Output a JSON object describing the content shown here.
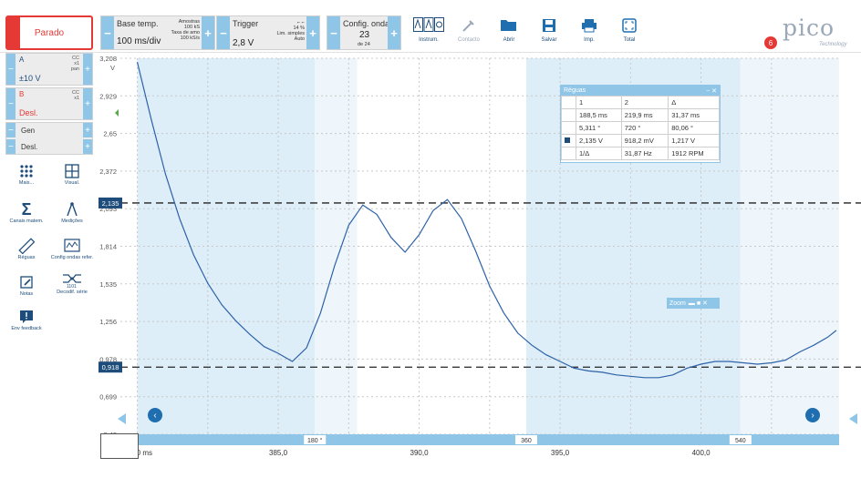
{
  "toolbar": {
    "stop_label": "Parado",
    "timebase": {
      "label": "Base temp.",
      "value": "100 ms/div",
      "samples_label": "Amostras",
      "samples_value": "100 kS",
      "rate_label": "Taxa de amo",
      "rate_value": "100 kS/s"
    },
    "trigger": {
      "label": "Trigger",
      "value": "2,8 V",
      "pct": "14 %",
      "mode": "Lim. simples",
      "auto": "Auto"
    },
    "config": {
      "label": "Config. onda",
      "value": "23",
      "sub": "de 24"
    },
    "icons": [
      {
        "name": "instrument-icon",
        "label": "Instrum."
      },
      {
        "name": "contact-icon",
        "label": "Contacto"
      },
      {
        "name": "open-icon",
        "label": "Abrir"
      },
      {
        "name": "save-icon",
        "label": "Salvar"
      },
      {
        "name": "print-icon",
        "label": "Imp."
      },
      {
        "name": "fullscreen-icon",
        "label": "Total"
      }
    ],
    "notification_count": "6",
    "logo": "pico",
    "logo_sub": "Technology"
  },
  "channels": {
    "a": {
      "name": "A",
      "range": "±10 V",
      "coupling": "CC",
      "extra": "x1",
      "filter": "pan"
    },
    "b": {
      "name": "B",
      "range": "Desl.",
      "coupling": "CC",
      "extra": "x1"
    },
    "gen": {
      "name": "Gen",
      "state": "Desl."
    }
  },
  "tools": [
    {
      "name": "more-icon",
      "label": "Mais..."
    },
    {
      "name": "view-icon",
      "label": "Visual."
    },
    {
      "name": "math-channels-icon",
      "label": "Canais matem."
    },
    {
      "name": "measurements-icon",
      "label": "Medições"
    },
    {
      "name": "rulers-icon",
      "label": "Réguas"
    },
    {
      "name": "reference-waveforms-icon",
      "label": "Config ondas refer."
    },
    {
      "name": "notes-icon",
      "label": "Notas"
    },
    {
      "name": "serial-decode-icon",
      "label": "Decodif. série"
    },
    {
      "name": "feedback-icon",
      "label": "Env feedback"
    }
  ],
  "chart_data": {
    "type": "line",
    "y_unit": "V",
    "yticks": [
      "3,208",
      "2,929",
      "2,65",
      "2,372",
      "2,093",
      "1,814",
      "1,535",
      "1,256",
      "0,978",
      "0,699",
      "0,42"
    ],
    "xticks": [
      "380,0 ms",
      "385,0",
      "390,0",
      "395,0",
      "400,0"
    ],
    "angle_marks": [
      "180 °",
      "360",
      "540"
    ],
    "ylim": [
      0.42,
      3.208
    ],
    "xlim": [
      379.4,
      404.9
    ],
    "series": [
      {
        "color": "#2e62a8",
        "x": [
          380.0,
          380.5,
          381.0,
          381.5,
          382.0,
          382.5,
          383.0,
          383.5,
          384.0,
          384.5,
          385.0,
          385.5,
          386.0,
          386.5,
          387.0,
          387.5,
          388.0,
          388.5,
          389.0,
          389.5,
          390.0,
          390.5,
          391.0,
          391.5,
          392.0,
          392.5,
          393.0,
          393.5,
          394.0,
          394.5,
          395.0,
          395.5,
          396.0,
          396.5,
          397.0,
          397.5,
          398.0,
          398.5,
          399.0,
          399.5,
          400.0,
          400.5,
          401.0,
          401.5,
          402.0,
          402.5,
          403.0,
          403.5,
          404.0,
          404.5,
          404.8
        ],
        "values": [
          3.18,
          2.75,
          2.35,
          2.02,
          1.75,
          1.54,
          1.38,
          1.26,
          1.16,
          1.07,
          1.02,
          0.96,
          1.06,
          1.32,
          1.67,
          1.97,
          2.12,
          2.05,
          1.88,
          1.77,
          1.9,
          2.08,
          2.16,
          2.02,
          1.78,
          1.52,
          1.32,
          1.17,
          1.08,
          1.01,
          0.96,
          0.91,
          0.89,
          0.88,
          0.86,
          0.85,
          0.84,
          0.84,
          0.86,
          0.91,
          0.94,
          0.96,
          0.96,
          0.95,
          0.94,
          0.95,
          0.97,
          1.03,
          1.08,
          1.14,
          1.19
        ]
      }
    ],
    "rulers": {
      "y1": "2,135",
      "y2": "0,918",
      "y1_value": 2.135,
      "y2_value": 0.918
    },
    "shaded_ranges": [
      [
        380.0,
        386.3
      ],
      [
        393.8,
        401.4
      ]
    ],
    "shaded_ranges_light": [
      [
        386.3,
        387.8
      ],
      [
        401.4,
        404.9
      ]
    ]
  },
  "ruler_table": {
    "title": "Réguas",
    "headers": [
      "",
      "1",
      "2",
      "Δ"
    ],
    "rows": [
      [
        "",
        "188,5 ms",
        "219,9 ms",
        "31,37 ms"
      ],
      [
        "",
        "5,311 °",
        "720 °",
        "80,06 °"
      ],
      [
        "",
        "2,135 V",
        "918,2 mV",
        "1,217 V"
      ],
      [
        "",
        "1/Δ",
        "31,87 Hz",
        "1912 RPM"
      ]
    ]
  },
  "zoom_label": "Zoom"
}
